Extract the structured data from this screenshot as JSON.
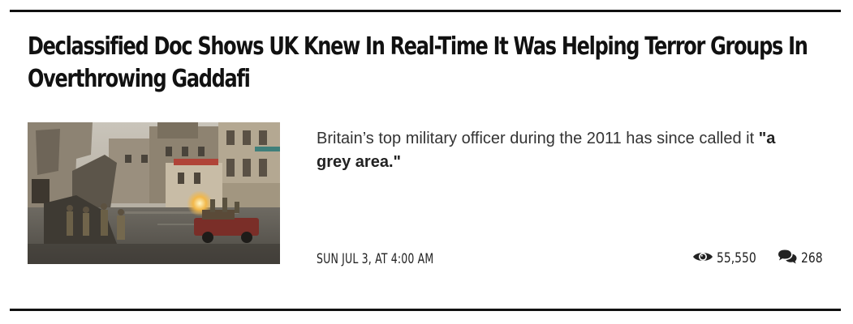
{
  "article": {
    "title": "Declassified Doc Shows UK Knew In Real-Time It Was Helping Terror Groups In Overthrowing Gaddafi",
    "excerpt_text": "Britain’s top military officer during the 2011 has since called it ",
    "excerpt_quote": "\"a grey area.\"",
    "date": "SUN JUL 3, AT 4:00 AM",
    "views": "55,550",
    "comments": "268",
    "icons": {
      "views": "eye-icon",
      "comments": "comments-icon"
    }
  },
  "colors": {
    "text": "#222222",
    "rule": "#111111",
    "icon": "#222222"
  }
}
